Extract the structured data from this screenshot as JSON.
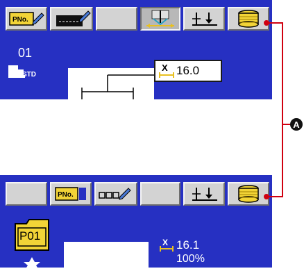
{
  "top_screen": {
    "pattern_no": "01",
    "std_label": "STD",
    "stitch_value": "16.0",
    "buttons": [
      {
        "icon": "pattern-number-edit-icon",
        "label": "PNo.",
        "pressed": false
      },
      {
        "icon": "pattern-shape-edit-icon",
        "label": "",
        "pressed": false
      },
      {
        "icon": "blank-key",
        "label": "",
        "pressed": false
      },
      {
        "icon": "needle-thread-trimming-icon",
        "label": "",
        "pressed": true
      },
      {
        "icon": "lower-bobbin-icon",
        "label": "",
        "pressed": false
      },
      {
        "icon": "bobbin-winding-icon",
        "label": "",
        "pressed": false
      }
    ]
  },
  "bottom_screen": {
    "pattern_folder": "P01",
    "stitch_value": "16.1",
    "scale": "100%",
    "buttons": [
      {
        "icon": "blank-key",
        "label": "",
        "pressed": false
      },
      {
        "icon": "pattern-number-select-icon",
        "label": "PNo.",
        "pressed": false
      },
      {
        "icon": "counter-edit-icon",
        "label": "",
        "pressed": false
      },
      {
        "icon": "blank-key",
        "label": "",
        "pressed": false
      },
      {
        "icon": "lower-bobbin-icon",
        "label": "",
        "pressed": false
      },
      {
        "icon": "bobbin-winding-icon",
        "label": "",
        "pressed": false
      }
    ]
  },
  "callout": {
    "label": "A",
    "color": "#d00010"
  },
  "colors": {
    "panel_bg": "#2630c2",
    "button_face": "#d3d3d3",
    "folder": "#f2d437"
  }
}
